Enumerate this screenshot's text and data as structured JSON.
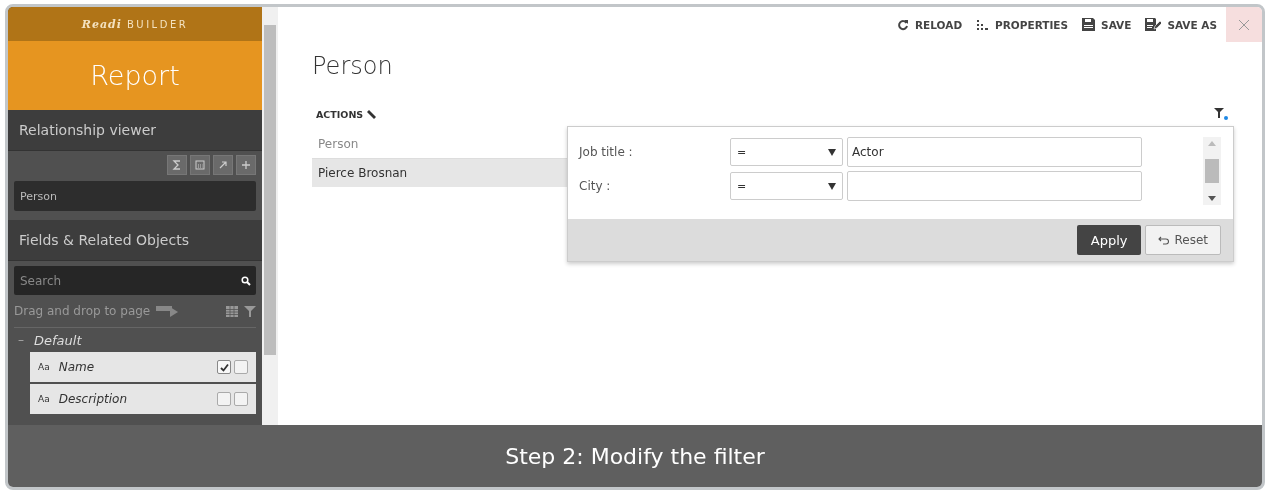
{
  "sidebar": {
    "brand_script": "Readi",
    "brand_word": "BUILDER",
    "title": "Report",
    "relationship_viewer": {
      "heading": "Relationship viewer",
      "root": "Person"
    },
    "fields": {
      "heading": "Fields & Related Objects",
      "search_placeholder": "Search",
      "hint": "Drag and drop to page",
      "group": {
        "label": "Default",
        "expanded": true,
        "toggle": "–",
        "items": [
          {
            "type_glyph": "Aa",
            "name": "Name",
            "checks": [
              {
                "checked": true
              },
              {
                "checked": false
              }
            ]
          },
          {
            "type_glyph": "Aa",
            "name": "Description",
            "checks": [
              {
                "checked": false
              },
              {
                "checked": false
              }
            ]
          }
        ]
      }
    }
  },
  "toolbar": [
    {
      "kind": "reload",
      "label": "RELOAD"
    },
    {
      "kind": "properties",
      "label": "PROPERTIES"
    },
    {
      "kind": "save",
      "label": "SAVE"
    },
    {
      "kind": "saveas",
      "label": "SAVE AS"
    }
  ],
  "page": {
    "title": "Person",
    "actions_label": "ACTIONS",
    "filter_active": true,
    "table": {
      "columns": [
        "Person"
      ],
      "rows": [
        {
          "cells": [
            "Pierce Brosnan"
          ],
          "selected": true
        }
      ]
    }
  },
  "filter_popup": {
    "conditions": [
      {
        "label": "Job title :",
        "operator": "=",
        "value": "Actor"
      },
      {
        "label": "City :",
        "operator": "="
      }
    ],
    "apply": "Apply",
    "reset": "Reset"
  },
  "caption": "Step 2: Modify the filter"
}
